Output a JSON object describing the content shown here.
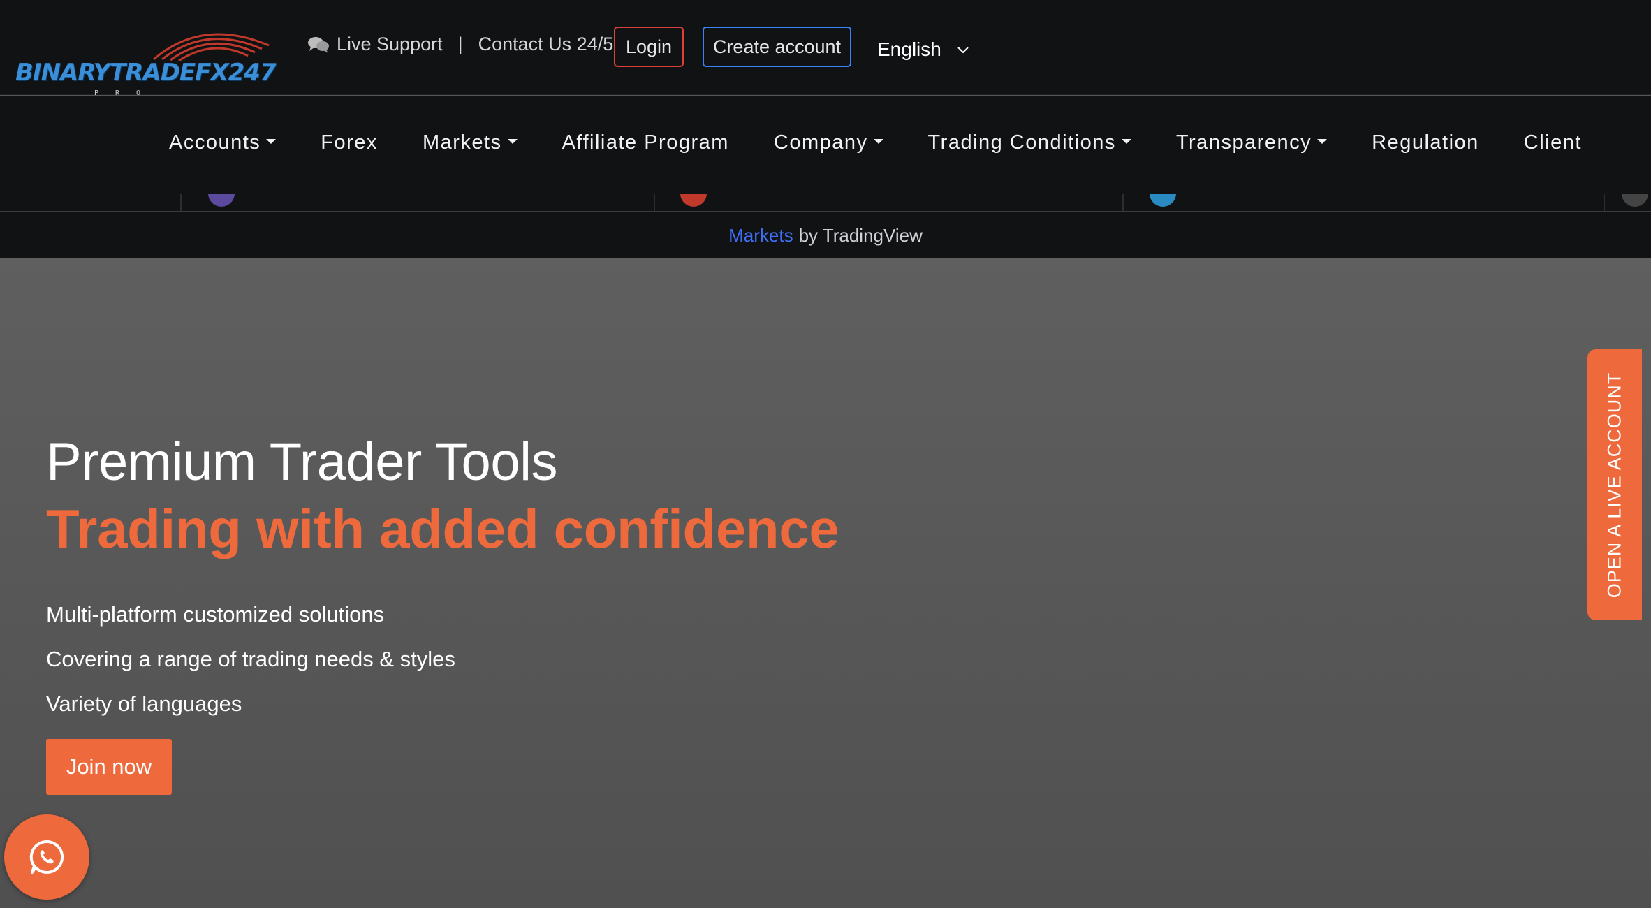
{
  "header": {
    "logo_text": "BINARYTRADEFX247",
    "logo_sub": "PRO",
    "live_support": "Live Support",
    "separator": "|",
    "contact": "Contact Us 24/5",
    "login_label": "Login",
    "create_account_label": "Create account",
    "language": "English"
  },
  "nav": {
    "items": [
      {
        "label": "Accounts",
        "dropdown": true
      },
      {
        "label": "Forex",
        "dropdown": false
      },
      {
        "label": "Markets",
        "dropdown": true
      },
      {
        "label": "Affiliate Program",
        "dropdown": false
      },
      {
        "label": "Company",
        "dropdown": true
      },
      {
        "label": "Trading Conditions",
        "dropdown": true
      },
      {
        "label": "Transparency",
        "dropdown": true
      },
      {
        "label": "Regulation",
        "dropdown": false
      },
      {
        "label": "Client",
        "dropdown": false
      }
    ]
  },
  "tradingview": {
    "link_text": "Markets",
    "suffix": "by TradingView"
  },
  "hero": {
    "title": "Premium Trader Tools",
    "subtitle": "Trading with added confidence",
    "points": [
      "Multi-platform customized solutions",
      "Covering a range of trading needs & styles",
      "Variety of languages"
    ],
    "cta_label": "Join now"
  },
  "side_tab": {
    "label": "OPEN A LIVE ACCOUNT"
  },
  "icons": {
    "chat": "chat-bubbles-icon",
    "chevron": "chevron-down-icon",
    "whatsapp": "whatsapp-icon"
  },
  "colors": {
    "accent_orange": "#ee6a3d",
    "login_border": "#d9413a",
    "create_border": "#3b82f6",
    "link_blue": "#3f6ff5",
    "header_bg": "#111213"
  }
}
